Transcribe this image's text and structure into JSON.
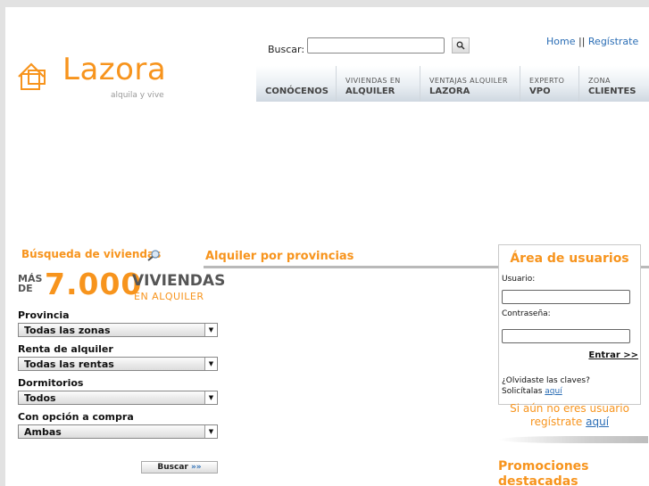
{
  "header": {
    "logo_text": "Lazora",
    "logo_tagline": "alquila y vive",
    "search_label": "Buscar:",
    "search_value": "",
    "top_links": {
      "home": "Home",
      "separator": "||",
      "register": "Regístrate"
    }
  },
  "nav": [
    {
      "small": "",
      "big": "CONÓCENOS"
    },
    {
      "small": "VIVIENDAS EN",
      "big": "ALQUILER"
    },
    {
      "small": "VENTAJAS ALQUILER",
      "big": "LAZORA"
    },
    {
      "small": "EXPERTO",
      "big": "VPO"
    },
    {
      "small": "ZONA",
      "big": "CLIENTES"
    }
  ],
  "search_panel": {
    "title": "Búsqueda de viviendas",
    "promo": {
      "mas": "MÁS",
      "de": "DE",
      "number": "7.000",
      "viviendas": "VIVIENDAS",
      "en_alquiler": "EN ALQUILER"
    },
    "filters": [
      {
        "label": "Provincia",
        "value": "Todas las zonas"
      },
      {
        "label": "Renta de alquiler",
        "value": "Todas las rentas"
      },
      {
        "label": "Dormitorios",
        "value": "Todos"
      },
      {
        "label": "Con opción a compra",
        "value": "Ambas"
      }
    ],
    "submit_label": "Buscar",
    "submit_arrows": "»»"
  },
  "main": {
    "title": "Alquiler por provincias"
  },
  "user_area": {
    "title": "Área de usuarios",
    "user_label": "Usuario:",
    "user_value": "",
    "password_label": "Contraseña:",
    "password_value": "",
    "enter_label": "Entrar >>",
    "forgot_line1": "¿Olvidaste las claves?",
    "forgot_line2": "Solicítalas",
    "forgot_link": "aquí",
    "register_line1": "Si aún no eres usuario",
    "register_line2": "regístrate",
    "register_link": "aquí"
  },
  "promotions": {
    "title": "Promociones destacadas"
  },
  "colors": {
    "accent": "#f7941d",
    "link": "#2a6db5",
    "page_bg": "#e2e2e2"
  }
}
